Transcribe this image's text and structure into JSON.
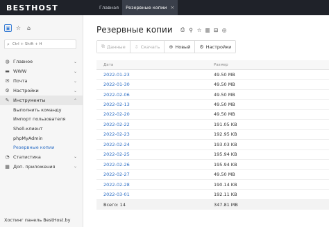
{
  "brand": "BESTHOST",
  "top_tabs": [
    {
      "label": "Главная"
    },
    {
      "label": "Резервные копии",
      "close": "×"
    }
  ],
  "sidebar": {
    "search_placeholder": "Ctrl + Shift + H",
    "nav": [
      {
        "label": "Главное",
        "icon": "globe-icon",
        "chevron": "⌄"
      },
      {
        "label": "WWW",
        "icon": "folder-icon",
        "chevron": "⌄"
      },
      {
        "label": "Почта",
        "icon": "mail-icon",
        "chevron": "⌄"
      },
      {
        "label": "Настройки",
        "icon": "gear-icon",
        "chevron": "⌄"
      },
      {
        "label": "Инструменты",
        "icon": "tools-icon",
        "chevron": "⌃"
      }
    ],
    "tools_sub": [
      {
        "label": "Выполнить команду"
      },
      {
        "label": "Импорт пользователя"
      },
      {
        "label": "Shell-клиент"
      },
      {
        "label": "phpMyAdmin"
      },
      {
        "label": "Резервные копии"
      }
    ],
    "nav_bottom": [
      {
        "label": "Статистика",
        "icon": "chart-icon",
        "chevron": "⌄"
      },
      {
        "label": "Доп. приложения",
        "icon": "apps-icon",
        "chevron": "⌄"
      }
    ],
    "footer": "Хостинг панель BestHost.by"
  },
  "main": {
    "title": "Резервные копии",
    "toolbar": {
      "data_label": "Данные",
      "download_label": "Скачать",
      "new_label": "Новый",
      "settings_label": "Настройки"
    },
    "table": {
      "col_date": "Дата",
      "col_size": "Размер",
      "rows": [
        {
          "date": "2022-01-23",
          "size": "49.50 MB"
        },
        {
          "date": "2022-01-30",
          "size": "49.50 MB"
        },
        {
          "date": "2022-02-06",
          "size": "49.50 MB"
        },
        {
          "date": "2022-02-13",
          "size": "49.50 MB"
        },
        {
          "date": "2022-02-20",
          "size": "49.50 MB"
        },
        {
          "date": "2022-02-22",
          "size": "191.05 KB"
        },
        {
          "date": "2022-02-23",
          "size": "192.95 KB"
        },
        {
          "date": "2022-02-24",
          "size": "193.03 KB"
        },
        {
          "date": "2022-02-25",
          "size": "195.94 KB"
        },
        {
          "date": "2022-02-26",
          "size": "195.94 KB"
        },
        {
          "date": "2022-02-27",
          "size": "49.50 MB"
        },
        {
          "date": "2022-02-28",
          "size": "190.14 KB"
        },
        {
          "date": "2022-03-01",
          "size": "192.11 KB"
        }
      ],
      "footer_count": "Всего: 14",
      "footer_size": "347.81 MB"
    }
  }
}
